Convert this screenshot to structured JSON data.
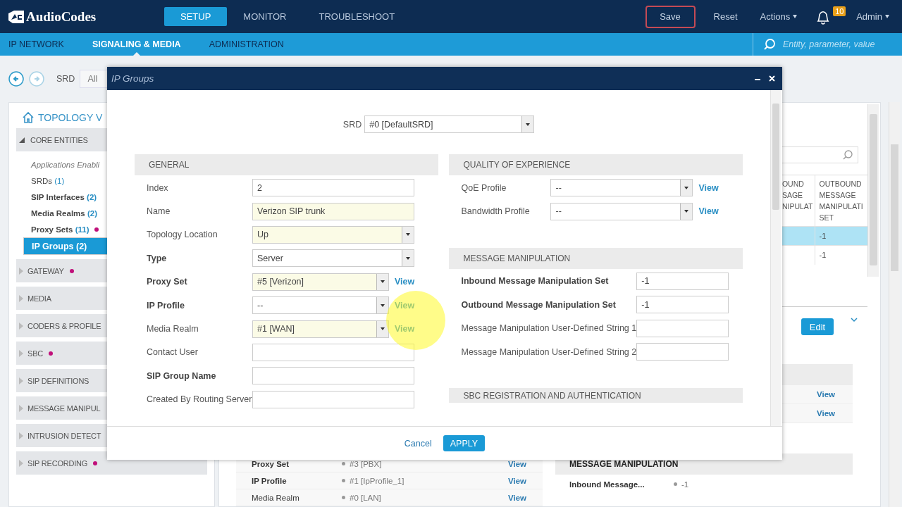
{
  "app_header": {
    "logo": "AudioCodes",
    "tabs": [
      {
        "label": "SETUP",
        "selected": true
      },
      {
        "label": "MONITOR",
        "selected": false
      },
      {
        "label": "TROUBLESHOOT",
        "selected": false
      }
    ],
    "actions": [
      {
        "kind": "outlined",
        "label": "Save"
      },
      {
        "kind": "link",
        "label": "Reset"
      },
      {
        "kind": "menu",
        "label": "Actions"
      },
      {
        "kind": "bell",
        "badge": "10"
      },
      {
        "kind": "menu",
        "label": "Admin"
      }
    ]
  },
  "sub_nav": {
    "tabs": [
      {
        "label": "IP NETWORK",
        "selected": false
      },
      {
        "label": "SIGNALING & MEDIA",
        "selected": true
      },
      {
        "label": "ADMINISTRATION",
        "selected": false
      }
    ],
    "search": {
      "placeholder": "Entity, parameter, value"
    }
  },
  "toolbar": {
    "nav": [
      {
        "kind": "back",
        "disabled": false
      },
      {
        "kind": "forward",
        "disabled": true
      }
    ],
    "filter_label": "SRD",
    "filter_value": "All"
  },
  "sidebar": {
    "title": "TOPOLOGY V",
    "groups": [
      {
        "label": "CORE ENTITIES",
        "expanded": true,
        "alert": false,
        "children": [
          {
            "label": "Applications Enabli",
            "kind": "note",
            "selected": false,
            "alert": false
          },
          {
            "label": "SRDs",
            "count": "(1)",
            "kind": "plain",
            "selected": false,
            "alert": false
          },
          {
            "label": "SIP Interfaces",
            "count": "(2)",
            "kind": "configured",
            "selected": false,
            "alert": false
          },
          {
            "label": "Media Realms",
            "count": "(2)",
            "kind": "configured",
            "selected": false,
            "alert": false
          },
          {
            "label": "Proxy Sets",
            "count": "(11)",
            "kind": "configured",
            "selected": false,
            "alert": true
          },
          {
            "label": "IP Groups",
            "count": "(2)",
            "kind": "configured",
            "selected": true,
            "alert": false
          }
        ]
      },
      {
        "label": "GATEWAY",
        "expanded": false,
        "alert": true
      },
      {
        "label": "MEDIA",
        "expanded": false,
        "alert": false
      },
      {
        "label": "CODERS & PROFILE",
        "expanded": false,
        "alert": false
      },
      {
        "label": "SBC",
        "expanded": false,
        "alert": true
      },
      {
        "label": "SIP DEFINITIONS",
        "expanded": false,
        "alert": false
      },
      {
        "label": "MESSAGE MANIPUL",
        "expanded": false,
        "alert": false
      },
      {
        "label": "INTRUSION DETECT",
        "expanded": false,
        "alert": false
      },
      {
        "label": "SIP RECORDING",
        "expanded": false,
        "alert": true
      }
    ]
  },
  "table": {
    "columns": [
      "OUND SAGE NIPULAT",
      "OUTBOUND MESSAGE MANIPULATI SET"
    ],
    "rows": [
      {
        "selected": true,
        "column_2": "-1"
      },
      {
        "selected": false,
        "column_2": "-1"
      }
    ]
  },
  "edit_button": "Edit",
  "details": {
    "links": [
      "View",
      "View"
    ],
    "properties": [
      {
        "label": "Proxy Set",
        "value": "#3 [PBX]",
        "link": "View",
        "required": true
      },
      {
        "label": "IP Profile",
        "value": "#1 [IpProfile_1]",
        "link": "View",
        "required": true
      },
      {
        "label": "Media Realm",
        "value": "#0 [LAN]",
        "link": "View",
        "required": false
      }
    ],
    "section": {
      "title": "MESSAGE MANIPULATION",
      "rows": [
        {
          "label": "Inbound Message...",
          "value": "-1"
        }
      ]
    }
  },
  "dialog": {
    "title": "IP Groups",
    "srd": {
      "label": "SRD",
      "value": "#0 [DefaultSRD]"
    },
    "columns": [
      [
        {
          "title": "GENERAL",
          "fields": [
            {
              "label": "Index",
              "kind": "text",
              "value": "2",
              "required": false,
              "modified": false
            },
            {
              "label": "Name",
              "kind": "text",
              "value": "Verizon SIP trunk",
              "required": false,
              "modified": true
            },
            {
              "label": "Topology Location",
              "kind": "select",
              "value": "Up",
              "required": false,
              "modified": true
            },
            {
              "label": "Type",
              "kind": "select",
              "value": "Server",
              "required": true,
              "modified": false
            },
            {
              "label": "Proxy Set",
              "kind": "select",
              "value": "#5 [Verizon]",
              "link": "View",
              "required": true,
              "modified": true
            },
            {
              "label": "IP Profile",
              "kind": "select",
              "value": "--",
              "link": "View",
              "required": true,
              "modified": false
            },
            {
              "label": "Media Realm",
              "kind": "select",
              "value": "#1 [WAN]",
              "link": "View",
              "required": false,
              "modified": true
            },
            {
              "label": "Contact User",
              "kind": "text",
              "required": false,
              "modified": false
            },
            {
              "label": "SIP Group Name",
              "kind": "text",
              "required": true,
              "modified": false
            },
            {
              "label": "Created By Routing Server",
              "kind": "text",
              "required": false,
              "modified": false
            }
          ]
        }
      ],
      [
        {
          "title": "QUALITY OF EXPERIENCE",
          "fields": [
            {
              "label": "QoE Profile",
              "kind": "select",
              "value": "--",
              "link": "View",
              "required": false,
              "modified": false
            },
            {
              "label": "Bandwidth Profile",
              "kind": "select",
              "value": "--",
              "link": "View",
              "required": false,
              "modified": false
            }
          ]
        },
        {
          "title": "MESSAGE MANIPULATION",
          "fields": [
            {
              "label": "Inbound Message Manipulation Set",
              "kind": "text",
              "value": "-1",
              "required": true,
              "modified": false
            },
            {
              "label": "Outbound Message Manipulation Set",
              "kind": "text",
              "value": "-1",
              "required": true,
              "modified": false
            },
            {
              "label": "Message Manipulation User-Defined String 1",
              "kind": "text",
              "required": false,
              "modified": false
            },
            {
              "label": "Message Manipulation User-Defined String 2",
              "kind": "text",
              "required": false,
              "modified": false
            }
          ]
        },
        {
          "title": "SBC REGISTRATION AND AUTHENTICATION"
        }
      ]
    ],
    "buttons": {
      "cancel": "Cancel",
      "apply": "APPLY"
    }
  }
}
